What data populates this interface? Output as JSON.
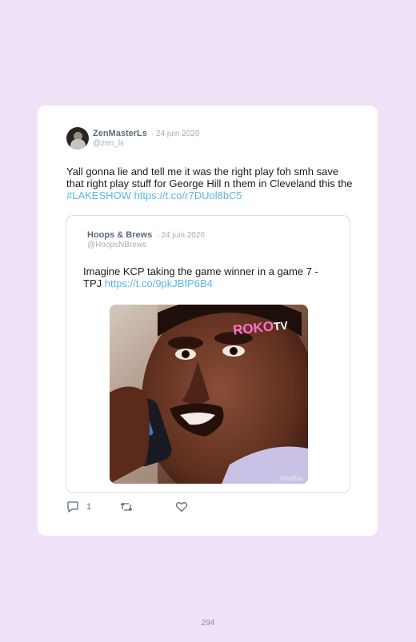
{
  "tweet": {
    "author_name": "ZenMasterLs",
    "date": "· 24 juin 2020",
    "handle": "@zen_ls",
    "text": "Yall gonna lie and tell me it was the right play foh smh save that right play stuff for George Hill n them in Cleveland this the ",
    "hashtag": "#LAKESHOW",
    "link": "https://t.co/r7DUol8bC5",
    "reply_count": "1"
  },
  "quote": {
    "author_name": "Hoops & Brews",
    "date": "· 24 juin 2020",
    "handle": "@HoopsNBrews",
    "text": "Imagine KCP taking the game winner in a game 7 -TPJ ",
    "link": "https://t.co/9pkJBfP6B4",
    "media_logo_pre": "ROKO",
    "media_logo_post": "TV",
    "media_watermark": "VineBox"
  },
  "icons": {
    "reply": "reply-icon",
    "retweet": "retweet-icon",
    "like": "heart-icon"
  },
  "page_number": "294"
}
